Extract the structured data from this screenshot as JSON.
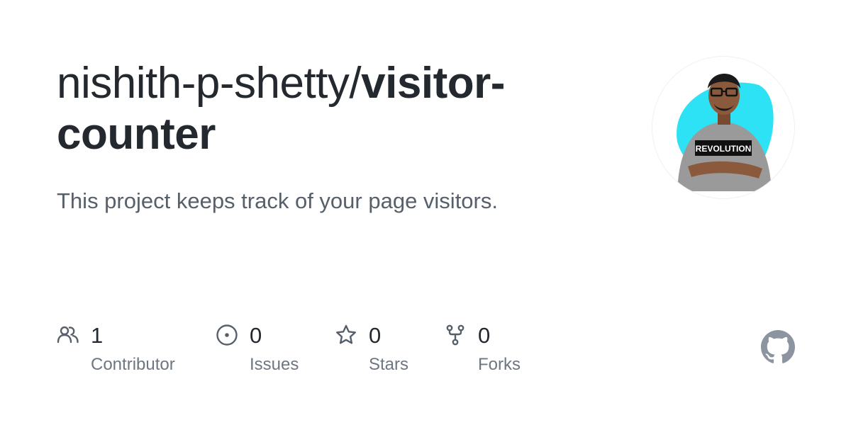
{
  "repo": {
    "owner": "nishith-p-shetty",
    "separator": "/",
    "name": "visitor-counter",
    "description": "This project keeps track of your page visitors."
  },
  "avatar": {
    "shirt_text": "REVOLUTION"
  },
  "stats": [
    {
      "icon": "people-icon",
      "count": "1",
      "label": "Contributor"
    },
    {
      "icon": "issue-icon",
      "count": "0",
      "label": "Issues"
    },
    {
      "icon": "star-icon",
      "count": "0",
      "label": "Stars"
    },
    {
      "icon": "fork-icon",
      "count": "0",
      "label": "Forks"
    }
  ],
  "colors": {
    "title": "#24292f",
    "muted": "#57606a",
    "icon": "#57606a",
    "github_logo": "#8c959f",
    "avatar_bg": "#2de2f5"
  }
}
